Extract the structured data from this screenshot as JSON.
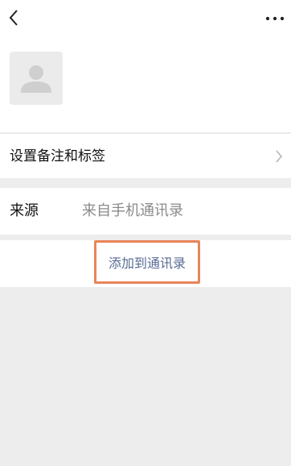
{
  "header": {
    "back_icon": "chevron-left-icon",
    "more_icon": "more-dots-icon"
  },
  "profile": {
    "avatar_icon": "default-person-avatar-icon"
  },
  "remark_row": {
    "label": "设置备注和标签",
    "chevron_icon": "chevron-right-icon"
  },
  "source_row": {
    "label": "来源",
    "value": "来自手机通讯录"
  },
  "add_row": {
    "button_label": "添加到通讯录",
    "highlight_color": "#e8845a",
    "link_color": "#576b95"
  }
}
